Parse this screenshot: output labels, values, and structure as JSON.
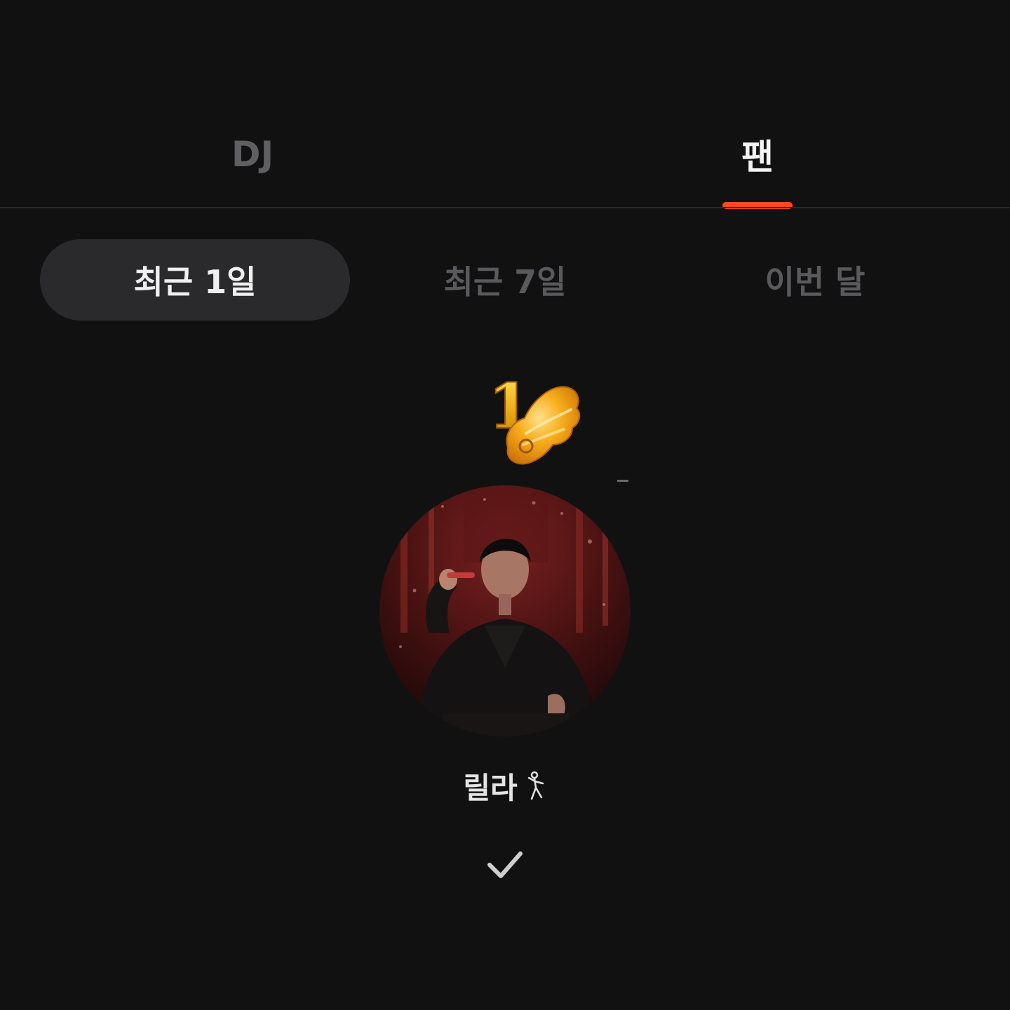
{
  "main_tabs": [
    {
      "label": "DJ",
      "active": false
    },
    {
      "label": "팬",
      "active": true
    }
  ],
  "period_tabs": [
    {
      "label": "최근 1일",
      "selected": true
    },
    {
      "label": "최근 7일",
      "selected": false
    },
    {
      "label": "이번 달",
      "selected": false
    }
  ],
  "ranking": {
    "rank": "1",
    "nickname": "릴라",
    "nickname_emoji": "dancing-figure-icon"
  },
  "icons": {
    "rank_badge": "gold-wing-rank-1-icon",
    "confirm": "checkmark-icon"
  },
  "colors": {
    "accent": "#ff4a1c",
    "background": "#111112",
    "rank_gold": "#f2b21a"
  }
}
